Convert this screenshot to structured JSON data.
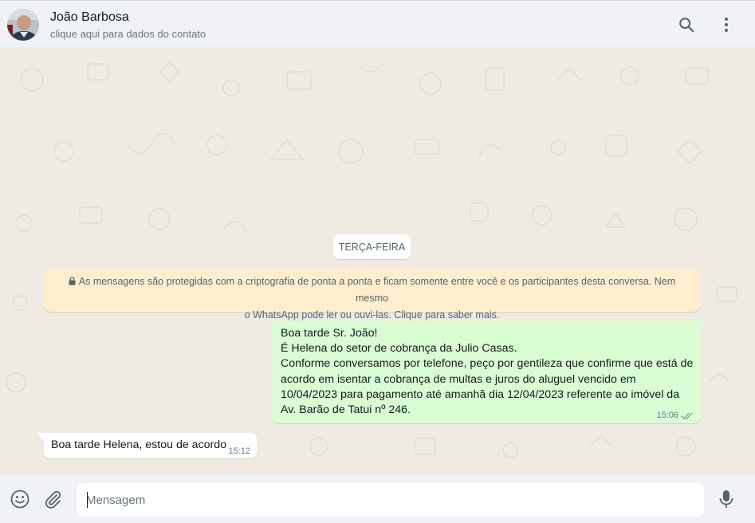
{
  "header": {
    "contact_name": "João Barbosa",
    "contact_subtitle": "clique aqui para dados do contato",
    "icons": [
      "avatar",
      "search-icon",
      "menu-icon"
    ]
  },
  "chat": {
    "date_chip": "TERÇA-FEIRA",
    "encryption_notice": {
      "line1": "As mensagens são protegidas com a criptografia de ponta a ponta e ficam somente entre você e os participantes desta conversa. Nem mesmo",
      "line2": "o WhatsApp pode ler ou ouvi-las. Clique para saber mais."
    },
    "messages": [
      {
        "direction": "outgoing",
        "lines": [
          "Boa tarde Sr. João!",
          "É Helena do setor de cobrança da Julio Casas.",
          "Conforme conversamos por telefone, peço por gentileza que confirme que está de",
          "acordo em isentar a cobrança de multas e juros do aluguel vencido em",
          "10/04/2023 para pagamento até amanhã dia 12/04/2023 referente ao imóvel da",
          "Av. Barão de Tatui nº 246."
        ],
        "time": "15:06",
        "status": "read"
      },
      {
        "direction": "incoming",
        "text": "Boa tarde Helena, estou de acordo",
        "time": "15:12"
      }
    ]
  },
  "composer": {
    "placeholder": "Mensagem",
    "value": ""
  },
  "colors": {
    "header_bg": "#f0f2f5",
    "chat_bg": "#efeae2",
    "outgoing_bubble": "#d9fdd3",
    "incoming_bubble": "#ffffff",
    "notice_bg": "#ffeecd",
    "read_tick": "#8696a0"
  }
}
